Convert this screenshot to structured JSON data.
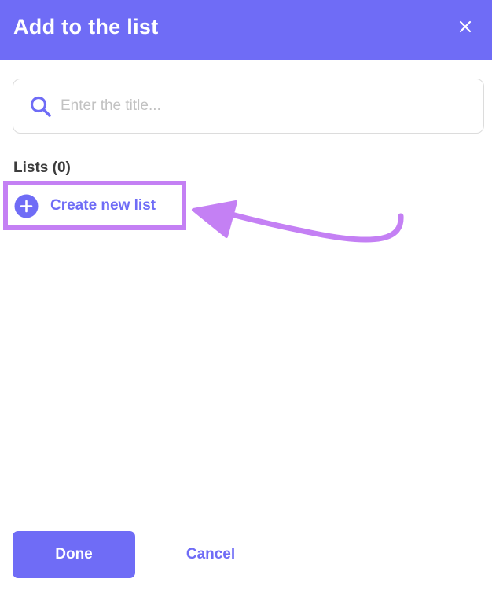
{
  "dialog": {
    "title": "Add to the list",
    "close_icon": "close-icon"
  },
  "search": {
    "placeholder": "Enter the title...",
    "value": "",
    "icon": "search-icon"
  },
  "lists": {
    "heading": "Lists (0)",
    "create_label": "Create new list",
    "create_icon": "plus-circle-icon"
  },
  "footer": {
    "done_label": "Done",
    "cancel_label": "Cancel"
  },
  "colors": {
    "accent": "#6f6cf6",
    "highlight": "#c480f4",
    "heading_text": "#3d3d3d",
    "placeholder_text": "#c2c2c2",
    "border": "#dcdcdc"
  }
}
